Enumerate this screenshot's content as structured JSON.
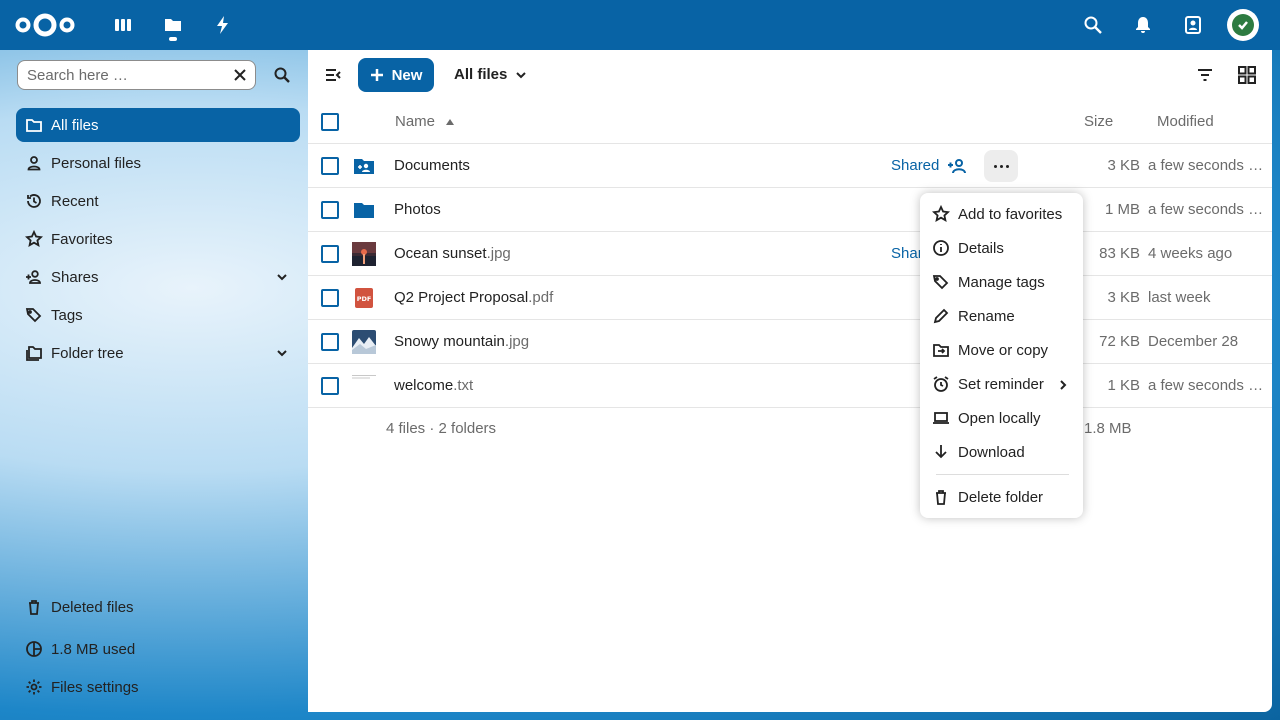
{
  "topbar": {
    "apps": [
      "dashboard",
      "files",
      "activity"
    ],
    "right_icons": [
      "search",
      "notifications",
      "contacts"
    ]
  },
  "sidebar": {
    "search_placeholder": "Search here …",
    "items": [
      {
        "label": "All files",
        "icon": "folder-icon"
      },
      {
        "label": "Personal files",
        "icon": "user-icon"
      },
      {
        "label": "Recent",
        "icon": "history-icon"
      },
      {
        "label": "Favorites",
        "icon": "star-icon"
      },
      {
        "label": "Shares",
        "icon": "share-icon"
      },
      {
        "label": "Tags",
        "icon": "tag-icon"
      },
      {
        "label": "Folder tree",
        "icon": "folder-multiple-icon"
      }
    ],
    "bottom": {
      "deleted": "Deleted files",
      "quota": "1.8 MB used",
      "settings": "Files settings"
    }
  },
  "main": {
    "new_label": "New",
    "breadcrumb": "All files",
    "columns": {
      "name": "Name",
      "size": "Size",
      "modified": "Modified"
    },
    "files": [
      {
        "name": "Documents",
        "ext": "",
        "type": "shared-folder",
        "shared": "Shared",
        "size": "3 KB",
        "modified": "a few seconds ago"
      },
      {
        "name": "Photos",
        "ext": "",
        "type": "folder",
        "shared": "",
        "size": "1 MB",
        "modified": "a few seconds ago"
      },
      {
        "name": "Ocean sunset",
        "ext": ".jpg",
        "type": "image",
        "shared": "Shar",
        "size": "83 KB",
        "modified": "4 weeks ago"
      },
      {
        "name": "Q2 Project Proposal",
        "ext": ".pdf",
        "type": "pdf",
        "shared": "",
        "size": "3 KB",
        "modified": "last week"
      },
      {
        "name": "Snowy mountain",
        "ext": ".jpg",
        "type": "image",
        "shared": "",
        "size": "72 KB",
        "modified": "December 28"
      },
      {
        "name": "welcome",
        "ext": ".txt",
        "type": "text",
        "shared": "",
        "size": "1 KB",
        "modified": "a few seconds ago"
      }
    ],
    "summary": "4 files · 2 folders",
    "summary_size": "1.8 MB"
  },
  "menu": {
    "items": [
      {
        "label": "Add to favorites",
        "icon": "star-icon"
      },
      {
        "label": "Details",
        "icon": "info-icon"
      },
      {
        "label": "Manage tags",
        "icon": "tag-icon"
      },
      {
        "label": "Rename",
        "icon": "pencil-icon"
      },
      {
        "label": "Move or copy",
        "icon": "folder-move-icon"
      },
      {
        "label": "Set reminder",
        "icon": "alarm-icon"
      },
      {
        "label": "Open locally",
        "icon": "laptop-icon"
      },
      {
        "label": "Download",
        "icon": "download-icon"
      },
      {
        "label": "Delete folder",
        "icon": "trash-icon"
      }
    ]
  },
  "colors": {
    "primary": "#0863a5",
    "text": "#222222",
    "muted": "#6b6b6b"
  }
}
